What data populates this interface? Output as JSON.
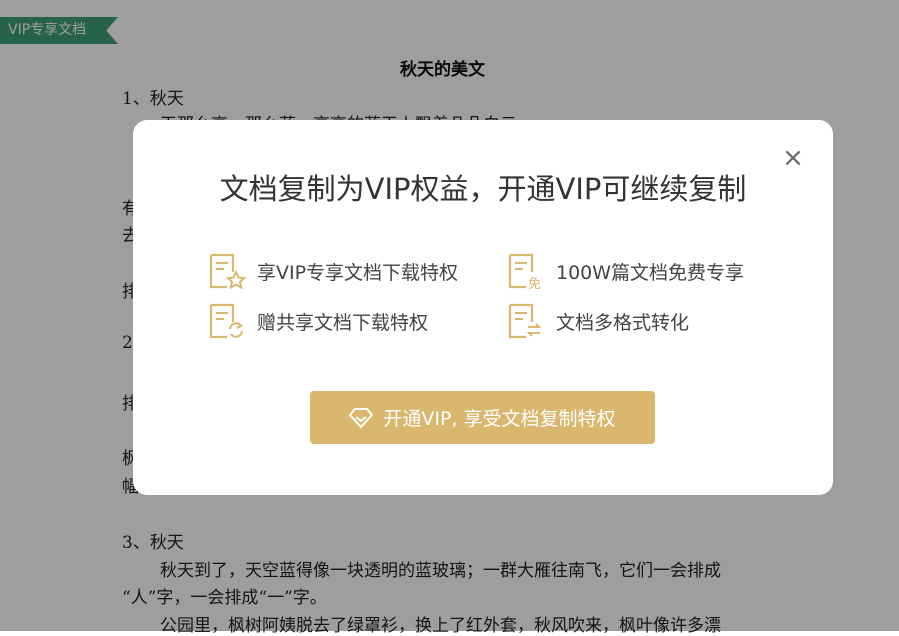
{
  "ribbon": {
    "label": "VIP专享文档"
  },
  "document": {
    "title": "秋天的美文",
    "lines": [
      "1、秋天",
      "天那么高，那么蓝。高高的蓝天上飘着几朵白云",
      "有",
      "去",
      "排",
      "2",
      "排",
      "枫",
      "幅",
      "3、秋天",
      "秋天到了，天空蓝得像一块透明的蓝玻璃；一群大雁往南飞，它们一会排成",
      "“人”字，一会排成“一”字。",
      "公园里，枫树阿姨脱去了绿罩衫，换上了红外套，秋风吹来，枫叶像许多漂"
    ]
  },
  "modal": {
    "title": "文档复制为VIP权益，开通VIP可继续复制",
    "close_label": "×",
    "features": [
      {
        "label": "享VIP专享文档下载特权",
        "icon": "star-doc-icon"
      },
      {
        "label": "100W篇文档免费专享",
        "icon": "free-doc-icon"
      },
      {
        "label": "赠共享文档下载特权",
        "icon": "refresh-doc-icon"
      },
      {
        "label": "文档多格式转化",
        "icon": "convert-doc-icon"
      }
    ],
    "cta_label": "开通VIP, 享受文档复制特权",
    "colors": {
      "accent": "#d9b76e",
      "ribbon": "#3f9e78"
    }
  }
}
